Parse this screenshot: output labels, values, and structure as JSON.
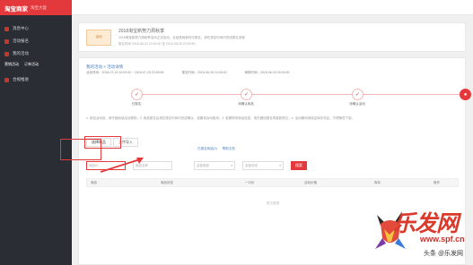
{
  "brand": {
    "logo": "淘宝商家",
    "tag": "淘宝大促"
  },
  "sidebar": {
    "items": [
      {
        "label": "消息中心"
      },
      {
        "label": "活动报名"
      },
      {
        "label": "我的活动"
      }
    ],
    "sub": [
      "营销活动",
      "订单活动"
    ],
    "extra": {
      "label": "合规推进"
    }
  },
  "notice": {
    "thumb": "活动",
    "title": "2018淘宝新势力周秋季",
    "desc": "2018淘宝新势力周秋季活动正式启动，全品类商家均可报名，请在规定时间内完成报名流程",
    "time": "报名时间 2018-08-24 10:00:00 至 2018-08-28 23:59:59"
  },
  "card": {
    "breadcrumb": "我的活动 > 活动详情",
    "meta": [
      "活动时间：2018-07-19 10:00:00 ~ 2018-07-25 23:59:59",
      "报名时间：2018-06-26 10:00:00",
      "审核时间：2018-06-29 00:00:00"
    ]
  },
  "steps": [
    {
      "label": "已报名",
      "icon": "✓"
    },
    {
      "label": "待确认商品",
      "icon": "✓"
    },
    {
      "label": "待确认活动",
      "icon": "✓"
    },
    {
      "label": "",
      "icon": "●"
    }
  ],
  "info": "1. 参加活动前，请仔细阅读活动规则；2. 商品报名后请在规定时间内完成确认，逾期将自动取消；3. 若需修改商品信息，请先撤回报名再重新提交；4. 活动期间请保证库存充足，不得随意下架。",
  "tabs": [
    {
      "label": "选择商品"
    },
    {
      "label": "上传导入"
    }
  ],
  "tab_links": [
    "已报名商品(0)",
    "帮助文档"
  ],
  "filters": {
    "input1": "商品ID",
    "input2": "商品名称",
    "select1": "全部类型",
    "select2": "全部状态",
    "search": "搜索"
  },
  "table": {
    "headers": [
      "商品",
      "商品状态",
      "一口价",
      "活动价格",
      "库存",
      "操作"
    ],
    "empty": "暂无数据"
  },
  "watermark": {
    "text": "乐发网",
    "url": "www.spf.cn",
    "sign": "头条 @乐发网"
  }
}
